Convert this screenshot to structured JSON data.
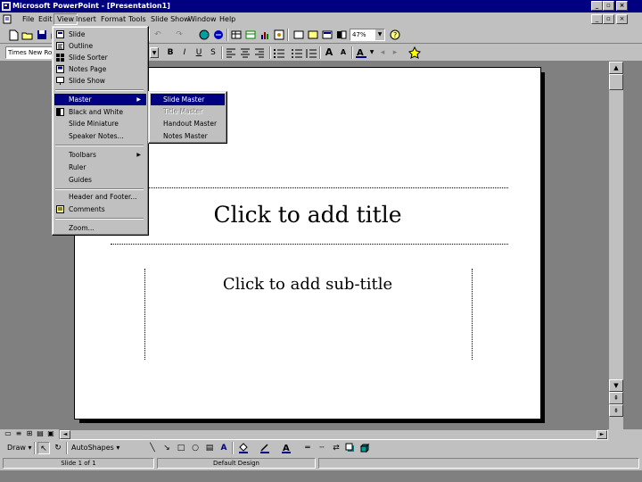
{
  "window": {
    "title": "Microsoft PowerPoint - [Presentation1]",
    "app_icon": "powerpoint-app-icon",
    "minimize": "_",
    "restore": "▫",
    "close": "×"
  },
  "menubar": {
    "items": [
      "File",
      "Edit",
      "View",
      "Insert",
      "Format",
      "Tools",
      "Slide Show",
      "Window",
      "Help"
    ],
    "doc_minimize": "_",
    "doc_restore": "▫",
    "doc_close": "×"
  },
  "toolbar_standard": {
    "zoom_value": "47%"
  },
  "toolbar_formatting": {
    "font_name": "Times New Ro",
    "font_size": "",
    "bold": "B",
    "italic": "I",
    "underline": "U",
    "shadow": "S",
    "increase_font": "A",
    "decrease_font": "A"
  },
  "view_menu": {
    "items": [
      {
        "label": "Slide",
        "icon": "slide-view-icon"
      },
      {
        "label": "Outline",
        "icon": "outline-view-icon"
      },
      {
        "label": "Slide Sorter",
        "icon": "slide-sorter-icon"
      },
      {
        "label": "Notes Page",
        "icon": "notes-page-icon"
      },
      {
        "label": "Slide Show",
        "icon": "slide-show-icon"
      },
      {
        "label": "Master",
        "icon": "",
        "submenu": true
      },
      {
        "label": "Black and White",
        "icon": "black-white-icon"
      },
      {
        "label": "Slide Miniature",
        "icon": ""
      },
      {
        "label": "Speaker Notes...",
        "icon": ""
      },
      {
        "label": "Toolbars",
        "icon": "",
        "submenu": true
      },
      {
        "label": "Ruler",
        "icon": ""
      },
      {
        "label": "Guides",
        "icon": ""
      },
      {
        "label": "Header and Footer...",
        "icon": ""
      },
      {
        "label": "Comments",
        "icon": "comments-icon"
      },
      {
        "label": "Zoom...",
        "icon": ""
      }
    ]
  },
  "master_submenu": {
    "items": [
      {
        "label": "Slide Master",
        "enabled": true
      },
      {
        "label": "Title Master",
        "enabled": false
      },
      {
        "label": "Handout Master",
        "enabled": true
      },
      {
        "label": "Notes Master",
        "enabled": true
      }
    ]
  },
  "slide": {
    "title_placeholder": "Click to add title",
    "subtitle_placeholder": "Click to add sub-title"
  },
  "drawing_toolbar": {
    "draw": "Draw",
    "autoshapes": "AutoShapes"
  },
  "statusbar": {
    "slide_info": "Slide 1 of 1",
    "design": "Default Design"
  },
  "colors": {
    "title_bar": "#000080",
    "face": "#c0c0c0",
    "highlight": "#000080",
    "workspace": "#808080"
  }
}
